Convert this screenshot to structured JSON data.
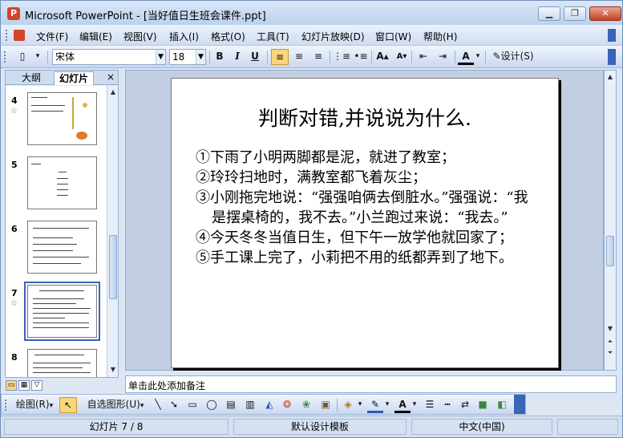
{
  "window": {
    "title": "Microsoft PowerPoint - [当好值日生班会课件.ppt]",
    "app_icon": "powerpoint-icon"
  },
  "menu": [
    "文件(F)",
    "编辑(E)",
    "视图(V)",
    "插入(I)",
    "格式(O)",
    "工具(T)",
    "幻灯片放映(D)",
    "窗口(W)",
    "帮助(H)"
  ],
  "toolbar": {
    "font_name": "宋体",
    "font_size": "18",
    "bold": "B",
    "italic": "I",
    "underline": "U",
    "design_label": "设计(S)"
  },
  "left_panel": {
    "tab_outline": "大纲",
    "tab_slides": "幻灯片",
    "close": "×",
    "slide_numbers": [
      "4",
      "5",
      "6",
      "7",
      "8"
    ],
    "selected_slide": "7"
  },
  "slide": {
    "title": "判断对错,并说说为什么.",
    "items": [
      "①下雨了小明两脚都是泥，就进了教室；",
      "②玲玲扫地时，满教室都飞着灰尘；",
      "③小刚拖完地说：“强强咱俩去倒脏水。”强强说：“我是摆桌椅的，我不去。”小兰跑过来说：“我去。”",
      "④今天冬冬当值日生，但下午一放学他就回家了；",
      "⑤手工课上完了，小莉把不用的纸都弄到了地下。"
    ]
  },
  "notes": {
    "placeholder": "单击此处添加备注"
  },
  "draw_toolbar": {
    "draw_label": "绘图(R)",
    "autoshape_label": "自选图形(U)"
  },
  "status": {
    "slide_info": "幻灯片 7 / 8",
    "template": "默认设计模板",
    "language": "中文(中国)"
  }
}
